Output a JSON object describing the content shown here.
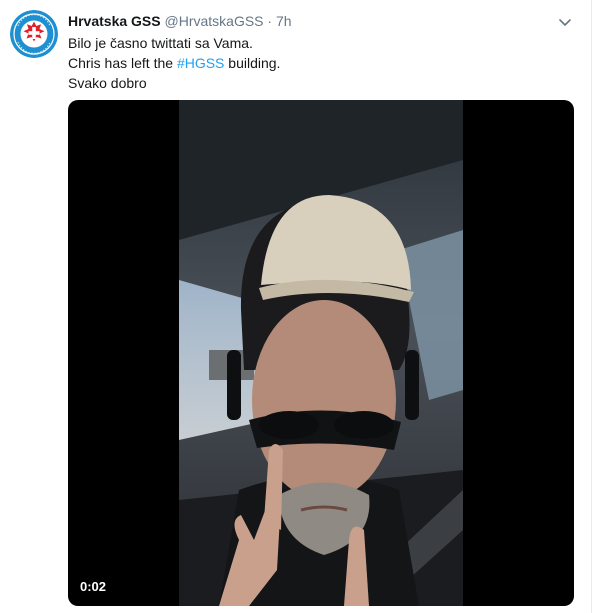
{
  "tweet": {
    "display_name": "Hrvatska GSS",
    "handle": "@HrvatskaGSS",
    "separator": "·",
    "time": "7h",
    "line1": "Bilo je časno twittati sa Vama.",
    "line2_before": "Chris has left the ",
    "hashtag": "#HGSS",
    "line2_after": " building.",
    "line3": "Svako dobro",
    "avatar_icon": "hgss-logo-icon",
    "menu_icon": "chevron-down-icon"
  },
  "video": {
    "duration": "0:02"
  },
  "colors": {
    "link": "#1da1f2",
    "secondary_text": "#657786",
    "primary_text": "#14171a",
    "avatar_bg": "#1e8fd0",
    "logo_red": "#e0202a"
  }
}
